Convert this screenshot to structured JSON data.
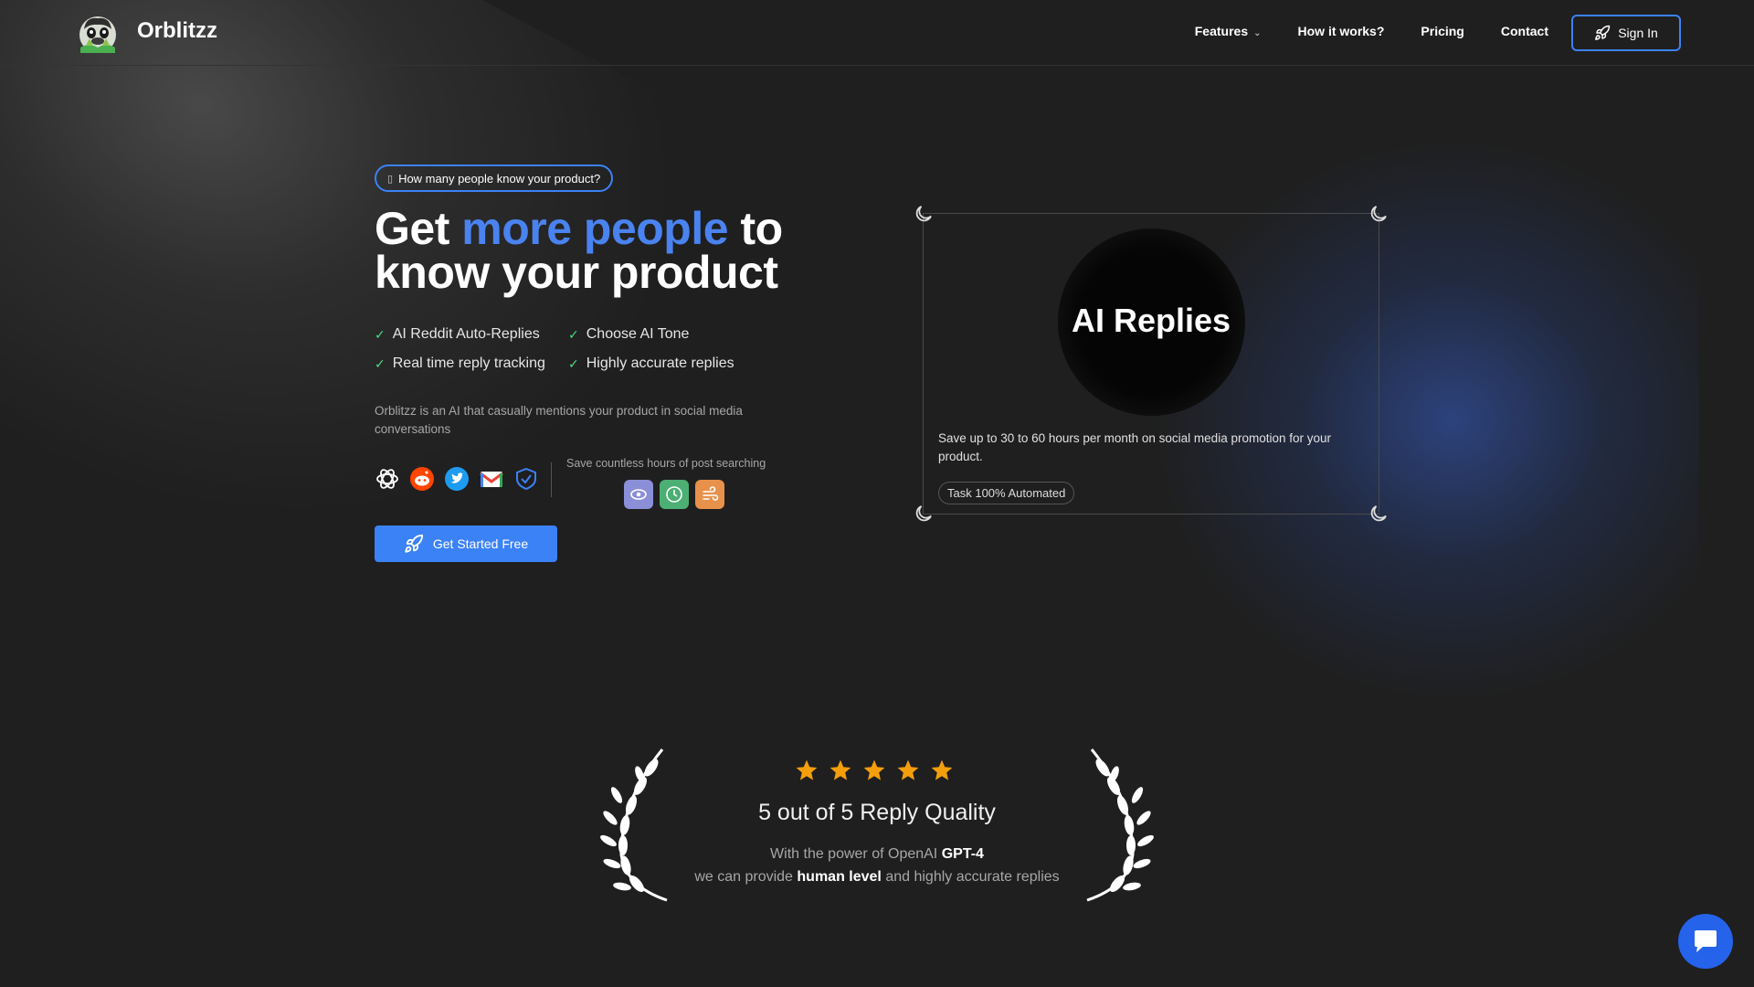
{
  "header": {
    "brand": "Orblitzz",
    "nav": [
      {
        "label": "Features"
      },
      {
        "label": "How it works?"
      },
      {
        "label": "Pricing"
      },
      {
        "label": "Contact"
      }
    ],
    "signin_label": "Sign In"
  },
  "hero": {
    "pill_text": "How many people know your product?",
    "headline_part1": "Get ",
    "headline_highlight": "more people",
    "headline_part2": " to know your product",
    "features": [
      "AI Reddit Auto-Replies",
      "Choose AI Tone",
      "Real time reply tracking",
      "Highly accurate replies"
    ],
    "description": "Orblitzz is an AI that casually mentions your product in social media conversations",
    "save_label": "Save countless hours of post searching",
    "cta_label": "Get Started Free",
    "accent_color": "#3b82f6"
  },
  "card": {
    "title": "AI Replies",
    "description": "Save up to 30 to 60 hours per month on social media promotion for your product.",
    "badge": "Task 100% Automated"
  },
  "reviews": {
    "stars": 5,
    "quality": "5 out of 5 Reply Quality",
    "power_prefix": "With the power of OpenAI ",
    "power_model": "GPT-4",
    "line2_prefix": "we can provide ",
    "line2_bold": "human level",
    "line2_suffix": " and highly accurate replies",
    "star_color": "#f59e0b"
  }
}
